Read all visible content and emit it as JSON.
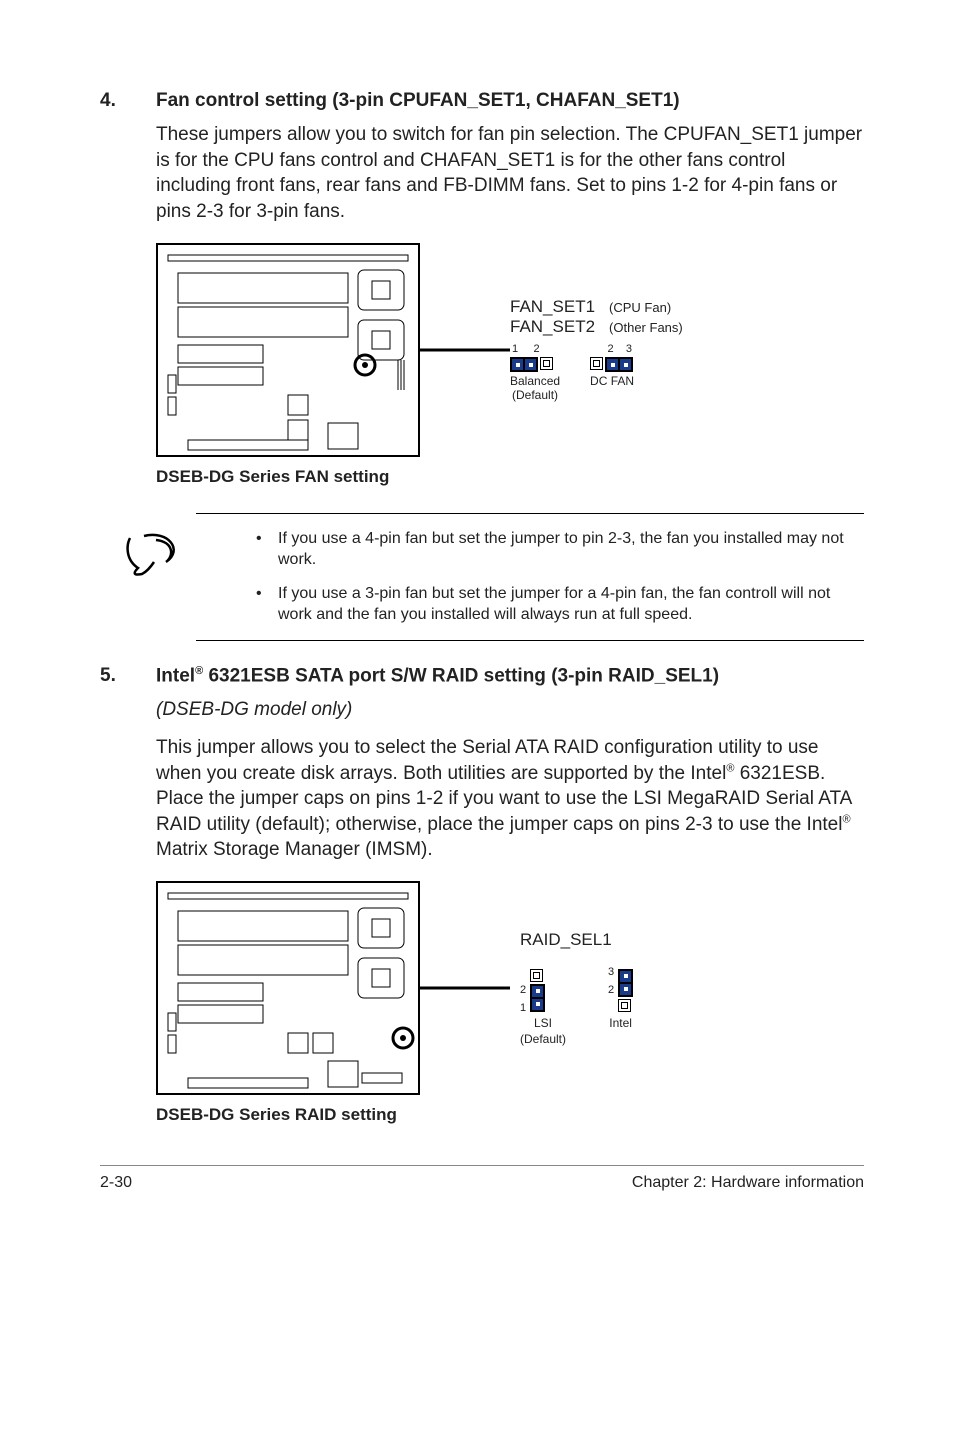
{
  "section4": {
    "num": "4.",
    "title": "Fan control setting (3-pin CPUFAN_SET1, CHAFAN_SET1)",
    "body": "These jumpers allow you to switch for fan pin selection. The CPUFAN_SET1 jumper is for the CPU fans control and CHAFAN_SET1 is for the other fans control including front fans, rear fans and FB-DIMM fans. Set to pins 1-2 for 4-pin fans or pins 2-3 for 3-pin fans.",
    "caption": "DSEB-DG Series FAN setting",
    "pin_name1": "FAN_SET1",
    "pin_desc1": "(CPU Fan)",
    "pin_name2": "FAN_SET2",
    "pin_desc2": "(Other Fans)",
    "j1_nums_l": "1",
    "j1_nums_r": "2",
    "j1_cap1": "Balanced",
    "j1_cap2": "(Default)",
    "j2_nums_l": "2",
    "j2_nums_r": "3",
    "j2_cap": "DC FAN"
  },
  "notes": {
    "b1": "If you use a 4-pin fan but set the jumper to pin 2-3, the fan you installed may not work.",
    "b2": "If you use a 3-pin fan but set the jumper for a 4-pin fan, the fan controll will not work and the fan you installed will always run at full speed."
  },
  "section5": {
    "num": "5.",
    "title_pre": "Intel",
    "title_sup": "®",
    "title_post": " 6321ESB SATA port S/W RAID setting (3-pin RAID_SEL1)",
    "subtitle": "(DSEB-DG model only)",
    "body_part1": "This jumper allows you to select the Serial ATA RAID configuration utility to use when you create disk arrays. Both utilities are supported by the Intel",
    "body_sup1": "®",
    "body_part2": " 6321ESB. Place the jumper caps on pins 1-2 if you want to use the LSI MegaRAID Serial ATA RAID utility (default); otherwise, place the jumper caps on pins 2-3 to use the Intel",
    "body_sup2": "®",
    "body_part3": " Matrix Storage Manager (IMSM).",
    "caption": "DSEB-DG Series RAID setting",
    "pin_name": "RAID_SEL1",
    "v1_n2": "2",
    "v1_n1": "1",
    "v1_cap1": "LSI",
    "v1_cap2": "(Default)",
    "v2_n3": "3",
    "v2_n2": "2",
    "v2_cap": "Intel"
  },
  "footer": {
    "left": "2-30",
    "right": "Chapter 2: Hardware information"
  }
}
